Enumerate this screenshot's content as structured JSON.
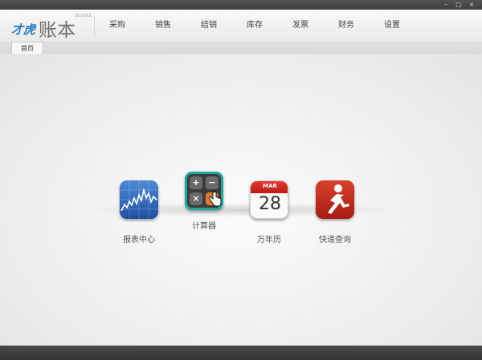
{
  "app": {
    "logo_brand": "才虎",
    "logo_title": "账本",
    "logo_sub": "BOOKS"
  },
  "window_controls": [
    "–",
    "□",
    "×"
  ],
  "nav": {
    "items": [
      {
        "label": "采购"
      },
      {
        "label": "销售"
      },
      {
        "label": "结销"
      },
      {
        "label": "库存"
      },
      {
        "label": "发票"
      },
      {
        "label": "财务"
      },
      {
        "label": "设置"
      }
    ]
  },
  "tabs": [
    {
      "label": "首页",
      "active": true
    }
  ],
  "apps": [
    {
      "label": "报表中心",
      "icon": "report-chart-icon"
    },
    {
      "label": "计算器",
      "icon": "calculator-icon",
      "keys": [
        "+",
        "−",
        "×",
        "="
      ]
    },
    {
      "label": "万年历",
      "icon": "calendar-icon",
      "month": "MAR",
      "day": "28"
    },
    {
      "label": "快递查询",
      "icon": "runner-icon"
    }
  ],
  "colors": {
    "brand_blue": "#2a7bbf",
    "calc_teal": "#22a59e",
    "calendar_red": "#d22a22",
    "runner_red": "#c52e20",
    "report_blue": "#2e64b8"
  }
}
